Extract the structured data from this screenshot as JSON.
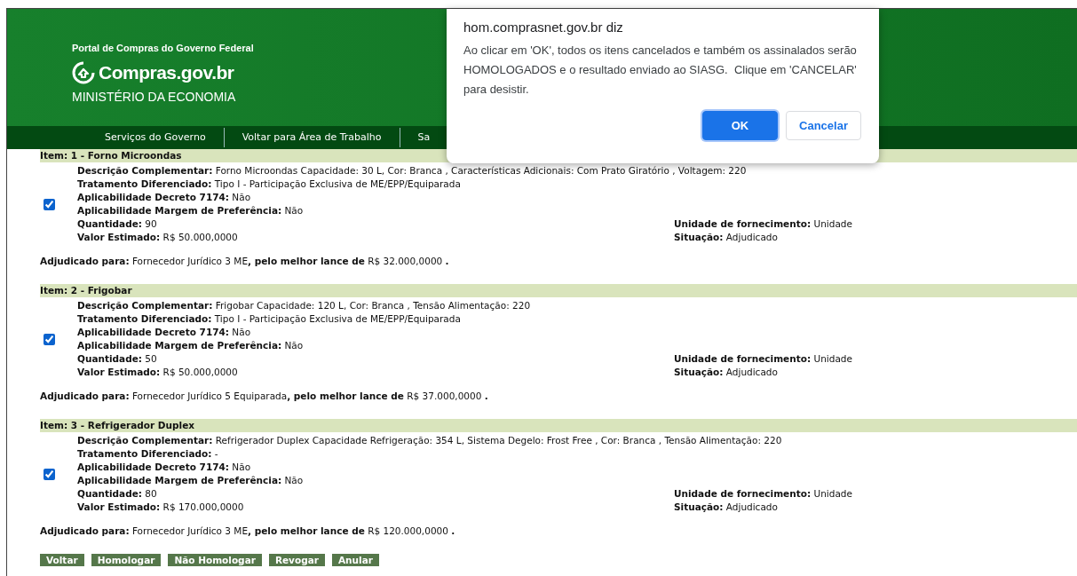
{
  "header": {
    "portal_label": "Portal de Compras do Governo Federal",
    "logo_text": "Compras.gov.br",
    "ministry": "MINISTÉRIO DA ECONOMIA"
  },
  "nav": [
    {
      "label": "Serviços do Governo"
    },
    {
      "label": "Voltar para Área de Trabalho"
    },
    {
      "label": "Sa"
    }
  ],
  "items": [
    {
      "title": "Item: 1 - Forno Microondas",
      "checked": true,
      "fields": [
        "**Descrição Complementar:** Forno Microondas Capacidade: 30 L, Cor: Branca , Características Adicionais: Com Prato Giratório , Voltagem: 220",
        "**Tratamento Diferenciado:** Tipo I - Participação Exclusiva de ME/EPP/Equiparada",
        "**Aplicabilidade Decreto 7174:** Não",
        "**Aplicabilidade Margem de Preferência:** Não"
      ],
      "paired": [
        [
          "**Quantidade:** 90",
          "**Unidade de fornecimento:** Unidade"
        ],
        [
          "**Valor Estimado:** R$ 50.000,0000",
          "**Situação:** Adjudicado"
        ]
      ],
      "award": "**Adjudicado para:** Fornecedor Jurídico 3 ME**, pelo melhor lance de** R$ 32.000,0000 **.**"
    },
    {
      "title": "Item: 2 - Frigobar",
      "checked": true,
      "fields": [
        "**Descrição Complementar:** Frigobar Capacidade: 120 L, Cor: Branca , Tensão Alimentação: 220",
        "**Tratamento Diferenciado:** Tipo I - Participação Exclusiva de ME/EPP/Equiparada",
        "**Aplicabilidade Decreto 7174:** Não",
        "**Aplicabilidade Margem de Preferência:** Não"
      ],
      "paired": [
        [
          "**Quantidade:** 50",
          "**Unidade de fornecimento:** Unidade"
        ],
        [
          "**Valor Estimado:** R$ 50.000,0000",
          "**Situação:** Adjudicado"
        ]
      ],
      "award": "**Adjudicado para:** Fornecedor Jurídico 5 Equiparada**, pelo melhor lance de** R$ 37.000,0000 **.**"
    },
    {
      "title": "Item: 3 - Refrigerador Duplex",
      "checked": true,
      "fields": [
        "**Descrição Complementar:** Refrigerador Duplex Capacidade Refrigeração: 354 L, Sistema Degelo: Frost Free , Cor: Branca , Tensão Alimentação: 220",
        "**Tratamento Diferenciado:** -",
        "**Aplicabilidade Decreto 7174:** Não",
        "**Aplicabilidade Margem de Preferência:** Não"
      ],
      "paired": [
        [
          "**Quantidade:** 80",
          "**Unidade de fornecimento:** Unidade"
        ],
        [
          "**Valor Estimado:** R$ 170.000,0000",
          "**Situação:** Adjudicado"
        ]
      ],
      "award": "**Adjudicado para:** Fornecedor Jurídico 3 ME**, pelo melhor lance de** R$ 120.000,0000 **.**"
    }
  ],
  "actions": [
    {
      "label": "Voltar"
    },
    {
      "label": "Homologar"
    },
    {
      "label": "Não Homologar"
    },
    {
      "label": "Revogar"
    },
    {
      "label": "Anular"
    }
  ],
  "dialog": {
    "title": "hom.comprasnet.gov.br diz",
    "message": "Ao clicar em 'OK', todos os itens cancelados e também os assinalados serão HOMOLOGADOS e o resultado enviado ao SIASG.  Clique em 'CANCELAR' para desistir.",
    "buttons": [
      {
        "label": "OK",
        "kind": "primary"
      },
      {
        "label": "Cancelar",
        "kind": "secondary"
      }
    ]
  }
}
